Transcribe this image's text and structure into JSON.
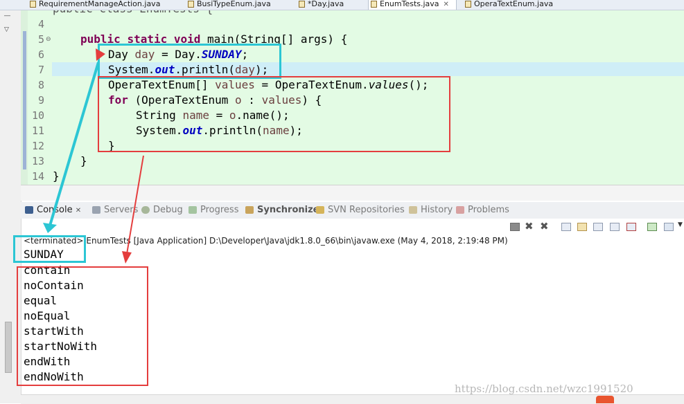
{
  "editor_tabs": [
    {
      "label": "RequirementManageAction.java",
      "active": false
    },
    {
      "label": "BusiTypeEnum.java",
      "active": false
    },
    {
      "label": "*Day.java",
      "active": false
    },
    {
      "label": "EnumTests.java",
      "active": true
    },
    {
      "label": "OperaTextEnum.java",
      "active": false
    }
  ],
  "editor": {
    "line_numbers": [
      "4",
      "5",
      "6",
      "7",
      "8",
      "9",
      "10",
      "11",
      "12",
      "13",
      "14"
    ],
    "top_partial_line": "public class EnumTests {",
    "code": {
      "l5_public": "public",
      "l5_static": "static",
      "l5_void": "void",
      "l5_rest": " main(String[] args) {",
      "l6_a": "Day ",
      "l6_var": "day",
      "l6_b": " = Day.",
      "l6_field": "SUNDAY",
      "l6_c": ";",
      "l7_a": "System.",
      "l7_out": "out",
      "l7_b": ".println(",
      "l7_var": "day",
      "l7_c": ");",
      "l8_a": "OperaTextEnum[] ",
      "l8_var": "values",
      "l8_b": " = OperaTextEnum.",
      "l8_m": "values",
      "l8_c": "();",
      "l9_for": "for",
      "l9_a": " (OperaTextEnum ",
      "l9_var": "o",
      "l9_b": " : ",
      "l9_var2": "values",
      "l9_c": ") {",
      "l10_a": "String ",
      "l10_var": "name",
      "l10_b": " = ",
      "l10_var2": "o",
      "l10_c": ".name();",
      "l11_a": "System.",
      "l11_out": "out",
      "l11_b": ".println(",
      "l11_var": "name",
      "l11_c": ");",
      "l12": "}",
      "l13": "}",
      "l14": "}"
    }
  },
  "view_tabs": [
    {
      "label": "Console",
      "icon": "console-icon",
      "close": "✕"
    },
    {
      "label": "Servers",
      "icon": "servers-icon"
    },
    {
      "label": "Debug",
      "icon": "debug-icon"
    },
    {
      "label": "Progress",
      "icon": "progress-icon"
    },
    {
      "label": "Synchronize",
      "icon": "synchronize-icon"
    },
    {
      "label": "SVN Repositories",
      "icon": "svn-icon"
    },
    {
      "label": "History",
      "icon": "history-icon"
    },
    {
      "label": "Problems",
      "icon": "problems-icon"
    }
  ],
  "console": {
    "title": "<terminated> EnumTests [Java Application] D:\\Developer\\Java\\jdk1.8.0_66\\bin\\javaw.exe (May 4, 2018, 2:19:48 PM)",
    "lines": [
      "SUNDAY",
      "contain",
      "noContain",
      "equal",
      "noEqual",
      "startWith",
      "startNoWith",
      "endWith",
      "endNoWith"
    ]
  },
  "watermark": "https://blog.csdn.net/wzc1991520",
  "colors": {
    "annotation_cyan": "#2cc6d4",
    "annotation_red": "#e43d3d",
    "editor_bg": "#e3fbe4",
    "keyword": "#7f0055",
    "field": "#0000c0"
  }
}
